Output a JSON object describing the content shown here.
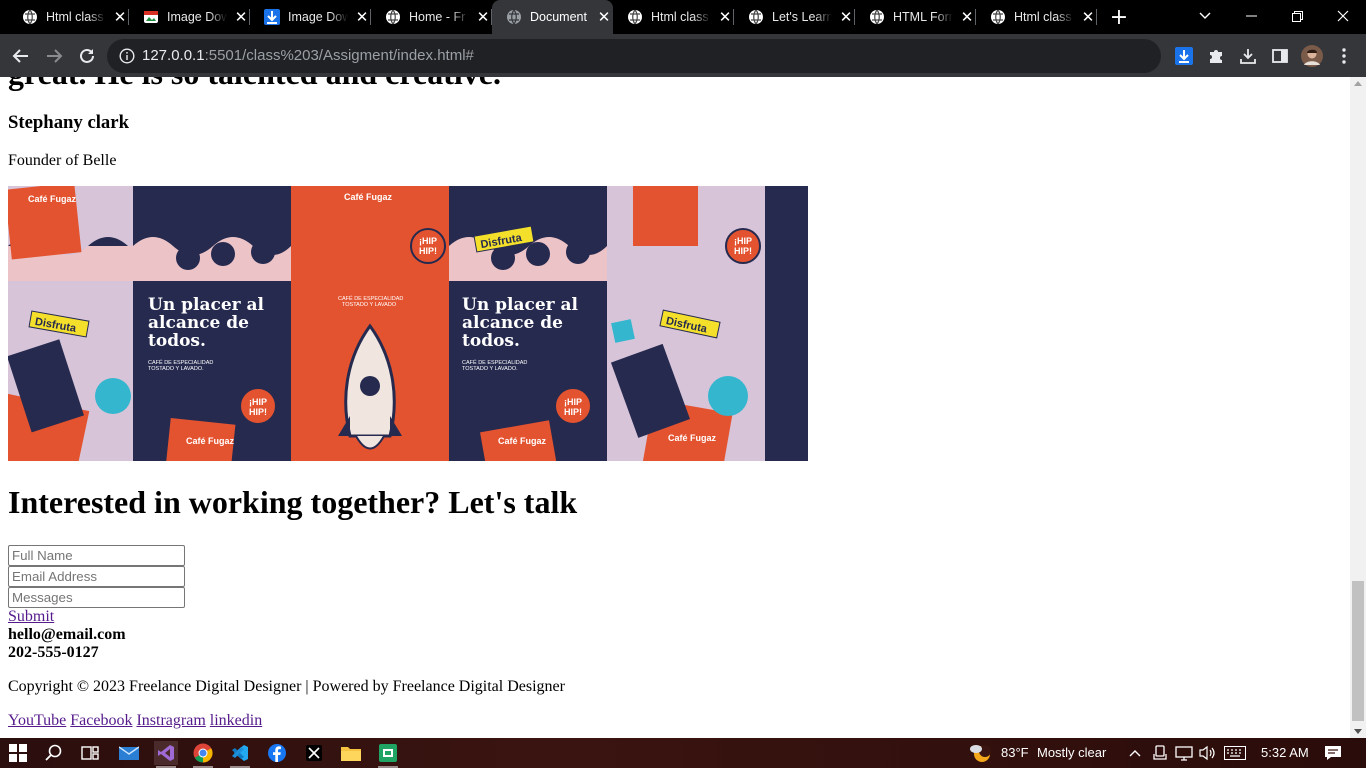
{
  "browser": {
    "tabs": [
      {
        "title": "Html class",
        "icon": "globe-icon",
        "active": false
      },
      {
        "title": "Image Dow",
        "icon": "image-site-icon",
        "active": false
      },
      {
        "title": "Image Dow",
        "icon": "download-site-icon",
        "active": false
      },
      {
        "title": "Home - Fr",
        "icon": "globe-icon",
        "active": false
      },
      {
        "title": "Document",
        "icon": "globe-icon",
        "active": true
      },
      {
        "title": "Html class",
        "icon": "globe-icon",
        "active": false
      },
      {
        "title": "Let's Learn",
        "icon": "globe-icon",
        "active": false
      },
      {
        "title": "HTML Form",
        "icon": "globe-icon",
        "active": false
      },
      {
        "title": "Html class",
        "icon": "globe-icon",
        "active": false
      }
    ],
    "address": {
      "host": "127.0.0.1",
      "rest": ":5501/class%203/Assigment/index.html#"
    }
  },
  "page": {
    "cut_heading": "great. He is so talented and creative.",
    "testimonial_name": "Stephany clark",
    "testimonial_role": "Founder of Belle",
    "poster": {
      "panel_headline": [
        "Un placer al",
        "alcance de",
        "todos."
      ],
      "panel_sub": [
        "CAFÉ DE ESPECIALIDAD",
        "TOSTADO Y LAVADO."
      ],
      "brand": "Café Fugaz",
      "sticker_hip": [
        "¡HIP",
        "HIP!"
      ],
      "sticker_disfruta": "Disfruta",
      "rocket_caption": [
        "CAFÉ DE ESPECIALIDAD",
        "TOSTADO Y LAVADO"
      ],
      "colors": {
        "navy": "#262a4f",
        "orange": "#e4532f",
        "pink": "#ecc4c8",
        "cream": "#f1e6df",
        "teal": "#35b6cf",
        "yellow": "#f4e02a"
      }
    },
    "cta_heading": "Interested in working together? Let's talk",
    "form": {
      "name_placeholder": "Full Name",
      "email_placeholder": "Email Address",
      "message_placeholder": "Messages",
      "submit_label": "Submit"
    },
    "contact_email": "hello@email.com",
    "contact_phone": "202-555-0127",
    "copyright": "Copyright © 2023 Freelance Digital Designer | Powered by Freelance Digital Designer",
    "social": [
      "YouTube",
      "Facebook",
      "Instragram",
      "linkedin"
    ]
  },
  "taskbar": {
    "weather_temp": "83°F",
    "weather_desc": "Mostly clear",
    "clock": "5:32 AM"
  }
}
